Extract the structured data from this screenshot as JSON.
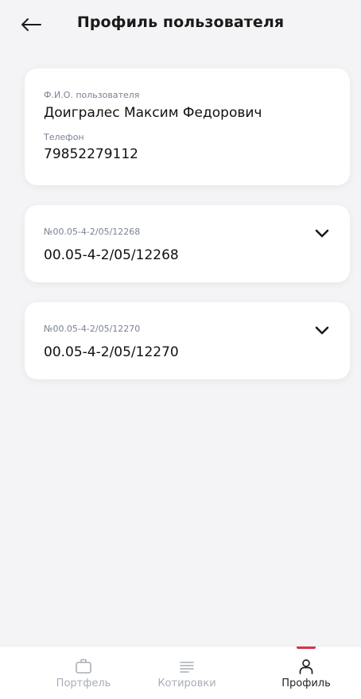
{
  "header": {
    "title": "Профиль пользователя",
    "back_icon": "arrow-left-icon"
  },
  "user_card": {
    "name_label": "Ф.И.О. пользователя",
    "name_value": "Доигралес Максим Федорович",
    "phone_label": "Телефон",
    "phone_value": "79852279112"
  },
  "accounts": [
    {
      "label": "№00.05-4-2/05/12268",
      "value": "00.05-4-2/05/12268",
      "expand_icon": "chevron-down-icon"
    },
    {
      "label": "№00.05-4-2/05/12270",
      "value": "00.05-4-2/05/12270",
      "expand_icon": "chevron-down-icon"
    }
  ],
  "tabbar": {
    "tabs": [
      {
        "label": "Портфель",
        "icon": "briefcase-icon",
        "active": false
      },
      {
        "label": "Котировки",
        "icon": "list-icon",
        "active": false
      },
      {
        "label": "Профиль",
        "icon": "user-icon",
        "active": true
      }
    ]
  },
  "colors": {
    "accent": "#d8334a",
    "background": "#f4f4f6",
    "card": "#ffffff",
    "label": "#7a8296",
    "tab_inactive": "#a9adb8"
  }
}
